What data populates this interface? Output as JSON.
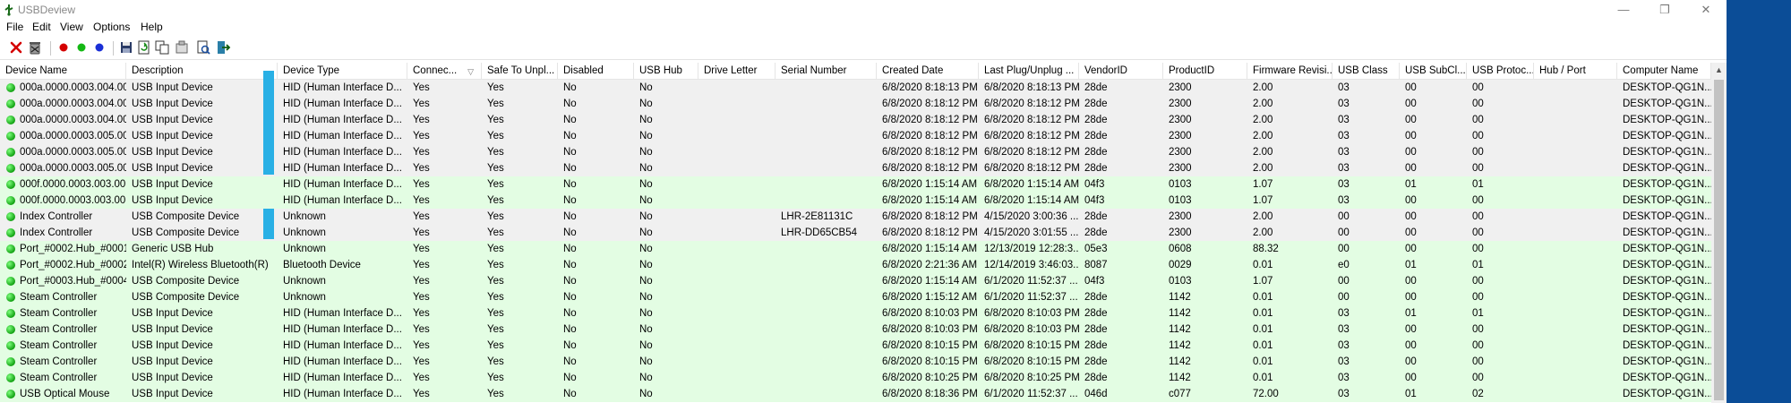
{
  "window": {
    "title": "USBDeview",
    "minimize": "—",
    "restore": "❐",
    "close": "✕"
  },
  "menu": [
    "File",
    "Edit",
    "View",
    "Options",
    "Help"
  ],
  "toolbar": {
    "buttons": [
      "disconnect-icon",
      "uninstall-icon",
      "red-ball-icon",
      "green-ball-icon",
      "blue-ball-icon",
      "save-icon",
      "refresh-icon",
      "copy-icon",
      "properties-icon",
      "html-report-icon",
      "exit-icon"
    ],
    "colors": {
      "red": "#d40000",
      "green": "#14b814",
      "blue": "#1a2fd6"
    }
  },
  "columns": [
    "Device Name",
    "Description",
    "Device Type",
    "Connec...",
    "Safe To Unpl...",
    "Disabled",
    "USB Hub",
    "Drive Letter",
    "Serial Number",
    "Created Date",
    "Last Plug/Unplug ...",
    "VendorID",
    "ProductID",
    "Firmware Revisi...",
    "USB Class",
    "USB SubCl...",
    "USB Protoc...",
    "Hub / Port",
    "Computer Name"
  ],
  "rows": [
    {
      "color": "gray",
      "cells": [
        "000a.0000.0003.004.00...",
        "USB Input Device",
        "HID (Human Interface D...",
        "Yes",
        "Yes",
        "No",
        "No",
        "",
        "",
        "6/8/2020 8:18:13 PM",
        "6/8/2020 8:18:13 PM",
        "28de",
        "2300",
        "2.00",
        "03",
        "00",
        "00",
        "",
        "DESKTOP-QG1N..."
      ]
    },
    {
      "color": "gray",
      "cells": [
        "000a.0000.0003.004.00...",
        "USB Input Device",
        "HID (Human Interface D...",
        "Yes",
        "Yes",
        "No",
        "No",
        "",
        "",
        "6/8/2020 8:18:12 PM",
        "6/8/2020 8:18:12 PM",
        "28de",
        "2300",
        "2.00",
        "03",
        "00",
        "00",
        "",
        "DESKTOP-QG1N..."
      ]
    },
    {
      "color": "gray",
      "cells": [
        "000a.0000.0003.004.00...",
        "USB Input Device",
        "HID (Human Interface D...",
        "Yes",
        "Yes",
        "No",
        "No",
        "",
        "",
        "6/8/2020 8:18:12 PM",
        "6/8/2020 8:18:12 PM",
        "28de",
        "2300",
        "2.00",
        "03",
        "00",
        "00",
        "",
        "DESKTOP-QG1N..."
      ]
    },
    {
      "color": "gray",
      "cells": [
        "000a.0000.0003.005.00...",
        "USB Input Device",
        "HID (Human Interface D...",
        "Yes",
        "Yes",
        "No",
        "No",
        "",
        "",
        "6/8/2020 8:18:12 PM",
        "6/8/2020 8:18:12 PM",
        "28de",
        "2300",
        "2.00",
        "03",
        "00",
        "00",
        "",
        "DESKTOP-QG1N..."
      ]
    },
    {
      "color": "gray",
      "cells": [
        "000a.0000.0003.005.00...",
        "USB Input Device",
        "HID (Human Interface D...",
        "Yes",
        "Yes",
        "No",
        "No",
        "",
        "",
        "6/8/2020 8:18:12 PM",
        "6/8/2020 8:18:12 PM",
        "28de",
        "2300",
        "2.00",
        "03",
        "00",
        "00",
        "",
        "DESKTOP-QG1N..."
      ]
    },
    {
      "color": "gray",
      "cells": [
        "000a.0000.0003.005.00...",
        "USB Input Device",
        "HID (Human Interface D...",
        "Yes",
        "Yes",
        "No",
        "No",
        "",
        "",
        "6/8/2020 8:18:12 PM",
        "6/8/2020 8:18:12 PM",
        "28de",
        "2300",
        "2.00",
        "03",
        "00",
        "00",
        "",
        "DESKTOP-QG1N..."
      ]
    },
    {
      "color": "green",
      "cells": [
        "000f.0000.0003.003.00...",
        "USB Input Device",
        "HID (Human Interface D...",
        "Yes",
        "Yes",
        "No",
        "No",
        "",
        "",
        "6/8/2020 1:15:14 AM",
        "6/8/2020 1:15:14 AM",
        "04f3",
        "0103",
        "1.07",
        "03",
        "01",
        "01",
        "",
        "DESKTOP-QG1N..."
      ]
    },
    {
      "color": "green",
      "cells": [
        "000f.0000.0003.003.00...",
        "USB Input Device",
        "HID (Human Interface D...",
        "Yes",
        "Yes",
        "No",
        "No",
        "",
        "",
        "6/8/2020 1:15:14 AM",
        "6/8/2020 1:15:14 AM",
        "04f3",
        "0103",
        "1.07",
        "03",
        "00",
        "00",
        "",
        "DESKTOP-QG1N..."
      ]
    },
    {
      "color": "gray",
      "cells": [
        "Index Controller",
        "USB Composite Device",
        "Unknown",
        "Yes",
        "Yes",
        "No",
        "No",
        "",
        "LHR-2E81131C",
        "6/8/2020 8:18:12 PM",
        "4/15/2020 3:00:36 ...",
        "28de",
        "2300",
        "2.00",
        "00",
        "00",
        "00",
        "",
        "DESKTOP-QG1N..."
      ]
    },
    {
      "color": "gray",
      "cells": [
        "Index Controller",
        "USB Composite Device",
        "Unknown",
        "Yes",
        "Yes",
        "No",
        "No",
        "",
        "LHR-DD65CB54",
        "6/8/2020 8:18:12 PM",
        "4/15/2020 3:01:55 ...",
        "28de",
        "2300",
        "2.00",
        "00",
        "00",
        "00",
        "",
        "DESKTOP-QG1N..."
      ]
    },
    {
      "color": "green",
      "cells": [
        "Port_#0002.Hub_#0001",
        "Generic USB Hub",
        "Unknown",
        "Yes",
        "Yes",
        "No",
        "No",
        "",
        "",
        "6/8/2020 1:15:14 AM",
        "12/13/2019 12:28:3...",
        "05e3",
        "0608",
        "88.32",
        "00",
        "00",
        "00",
        "",
        "DESKTOP-QG1N..."
      ]
    },
    {
      "color": "green",
      "cells": [
        "Port_#0002.Hub_#0002",
        "Intel(R) Wireless Bluetooth(R)",
        "Bluetooth Device",
        "Yes",
        "Yes",
        "No",
        "No",
        "",
        "",
        "6/8/2020 2:21:36 AM",
        "12/14/2019 3:46:03...",
        "8087",
        "0029",
        "0.01",
        "e0",
        "01",
        "01",
        "",
        "DESKTOP-QG1N..."
      ]
    },
    {
      "color": "green",
      "cells": [
        "Port_#0003.Hub_#0004",
        "USB Composite Device",
        "Unknown",
        "Yes",
        "Yes",
        "No",
        "No",
        "",
        "",
        "6/8/2020 1:15:14 AM",
        "6/1/2020 11:52:37 ...",
        "04f3",
        "0103",
        "1.07",
        "00",
        "00",
        "00",
        "",
        "DESKTOP-QG1N..."
      ]
    },
    {
      "color": "green",
      "cells": [
        "Steam Controller",
        "USB Composite Device",
        "Unknown",
        "Yes",
        "Yes",
        "No",
        "No",
        "",
        "",
        "6/8/2020 1:15:12 AM",
        "6/1/2020 11:52:37 ...",
        "28de",
        "1142",
        "0.01",
        "00",
        "00",
        "00",
        "",
        "DESKTOP-QG1N..."
      ]
    },
    {
      "color": "green",
      "cells": [
        "Steam Controller",
        "USB Input Device",
        "HID (Human Interface D...",
        "Yes",
        "Yes",
        "No",
        "No",
        "",
        "",
        "6/8/2020 8:10:03 PM",
        "6/8/2020 8:10:03 PM",
        "28de",
        "1142",
        "0.01",
        "03",
        "01",
        "01",
        "",
        "DESKTOP-QG1N..."
      ]
    },
    {
      "color": "green",
      "cells": [
        "Steam Controller",
        "USB Input Device",
        "HID (Human Interface D...",
        "Yes",
        "Yes",
        "No",
        "No",
        "",
        "",
        "6/8/2020 8:10:03 PM",
        "6/8/2020 8:10:03 PM",
        "28de",
        "1142",
        "0.01",
        "03",
        "00",
        "00",
        "",
        "DESKTOP-QG1N..."
      ]
    },
    {
      "color": "green",
      "cells": [
        "Steam Controller",
        "USB Input Device",
        "HID (Human Interface D...",
        "Yes",
        "Yes",
        "No",
        "No",
        "",
        "",
        "6/8/2020 8:10:15 PM",
        "6/8/2020 8:10:15 PM",
        "28de",
        "1142",
        "0.01",
        "03",
        "00",
        "00",
        "",
        "DESKTOP-QG1N..."
      ]
    },
    {
      "color": "green",
      "cells": [
        "Steam Controller",
        "USB Input Device",
        "HID (Human Interface D...",
        "Yes",
        "Yes",
        "No",
        "No",
        "",
        "",
        "6/8/2020 8:10:15 PM",
        "6/8/2020 8:10:15 PM",
        "28de",
        "1142",
        "0.01",
        "03",
        "00",
        "00",
        "",
        "DESKTOP-QG1N..."
      ]
    },
    {
      "color": "green",
      "cells": [
        "Steam Controller",
        "USB Input Device",
        "HID (Human Interface D...",
        "Yes",
        "Yes",
        "No",
        "No",
        "",
        "",
        "6/8/2020 8:10:25 PM",
        "6/8/2020 8:10:25 PM",
        "28de",
        "1142",
        "0.01",
        "03",
        "00",
        "00",
        "",
        "DESKTOP-QG1N..."
      ]
    },
    {
      "color": "green",
      "cells": [
        "USB Optical Mouse",
        "USB Input Device",
        "HID (Human Interface D...",
        "Yes",
        "Yes",
        "No",
        "No",
        "",
        "",
        "6/8/2020 8:18:36 PM",
        "6/1/2020 11:52:37 ...",
        "046d",
        "c077",
        "72.00",
        "03",
        "01",
        "02",
        "",
        "DESKTOP-QG1N..."
      ]
    }
  ]
}
